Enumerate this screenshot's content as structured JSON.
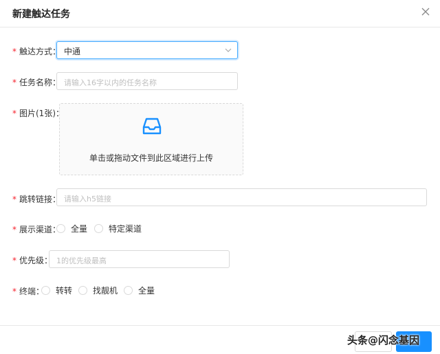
{
  "dialog": {
    "title": "新建触达任务"
  },
  "form": {
    "required_mark": "*",
    "reach_method": {
      "label": "触达方式：",
      "value": "中通"
    },
    "task_name": {
      "label": "任务名称：",
      "placeholder": "请输入16字以内的任务名称"
    },
    "image": {
      "label": "图片(1张)：",
      "upload_text": "单击或拖动文件到此区域进行上传"
    },
    "jump_link": {
      "label": "跳转链接：",
      "placeholder": "请输入h5链接"
    },
    "display_channel": {
      "label": "展示渠道：",
      "options": [
        "全量",
        "特定渠道"
      ]
    },
    "priority": {
      "label": "优先级：",
      "placeholder": "1的优先级最高"
    },
    "terminal": {
      "label": "终端：",
      "options": [
        "转转",
        "找靓机",
        "全量"
      ]
    }
  },
  "watermark": "头条@闪念基因",
  "colors": {
    "accent": "#1890ff",
    "required": "#f5222d"
  }
}
